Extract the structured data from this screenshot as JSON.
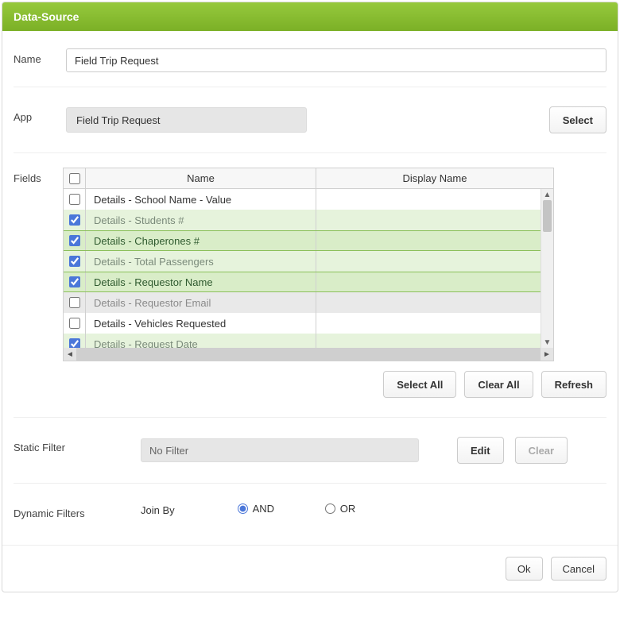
{
  "header": {
    "title": "Data-Source"
  },
  "name": {
    "label": "Name",
    "value": "Field Trip Request"
  },
  "app": {
    "label": "App",
    "value": "Field Trip Request",
    "select_btn": "Select"
  },
  "fields": {
    "label": "Fields",
    "columns": {
      "name": "Name",
      "display": "Display Name"
    },
    "rows": [
      {
        "checked": false,
        "style": "white",
        "name": "Details - School Name - Value",
        "display": ""
      },
      {
        "checked": true,
        "style": "sel-light",
        "name": "Details - Students #",
        "display": ""
      },
      {
        "checked": true,
        "style": "sel-dark",
        "name": "Details - Chaperones #",
        "display": ""
      },
      {
        "checked": true,
        "style": "sel-light",
        "name": "Details - Total Passengers",
        "display": ""
      },
      {
        "checked": true,
        "style": "sel-dark",
        "name": "Details - Requestor Name",
        "display": ""
      },
      {
        "checked": false,
        "style": "grey",
        "name": "Details - Requestor Email",
        "display": ""
      },
      {
        "checked": false,
        "style": "white",
        "name": "Details - Vehicles Requested",
        "display": ""
      },
      {
        "checked": true,
        "style": "sel-light",
        "name": "Details - Request Date",
        "display": ""
      }
    ],
    "buttons": {
      "select_all": "Select All",
      "clear_all": "Clear All",
      "refresh": "Refresh"
    }
  },
  "static_filter": {
    "label": "Static Filter",
    "value": "No Filter",
    "edit": "Edit",
    "clear": "Clear"
  },
  "dynamic_filters": {
    "label": "Dynamic Filters",
    "join_by_label": "Join By",
    "and": "AND",
    "or": "OR",
    "selected": "AND"
  },
  "footer": {
    "ok": "Ok",
    "cancel": "Cancel"
  }
}
